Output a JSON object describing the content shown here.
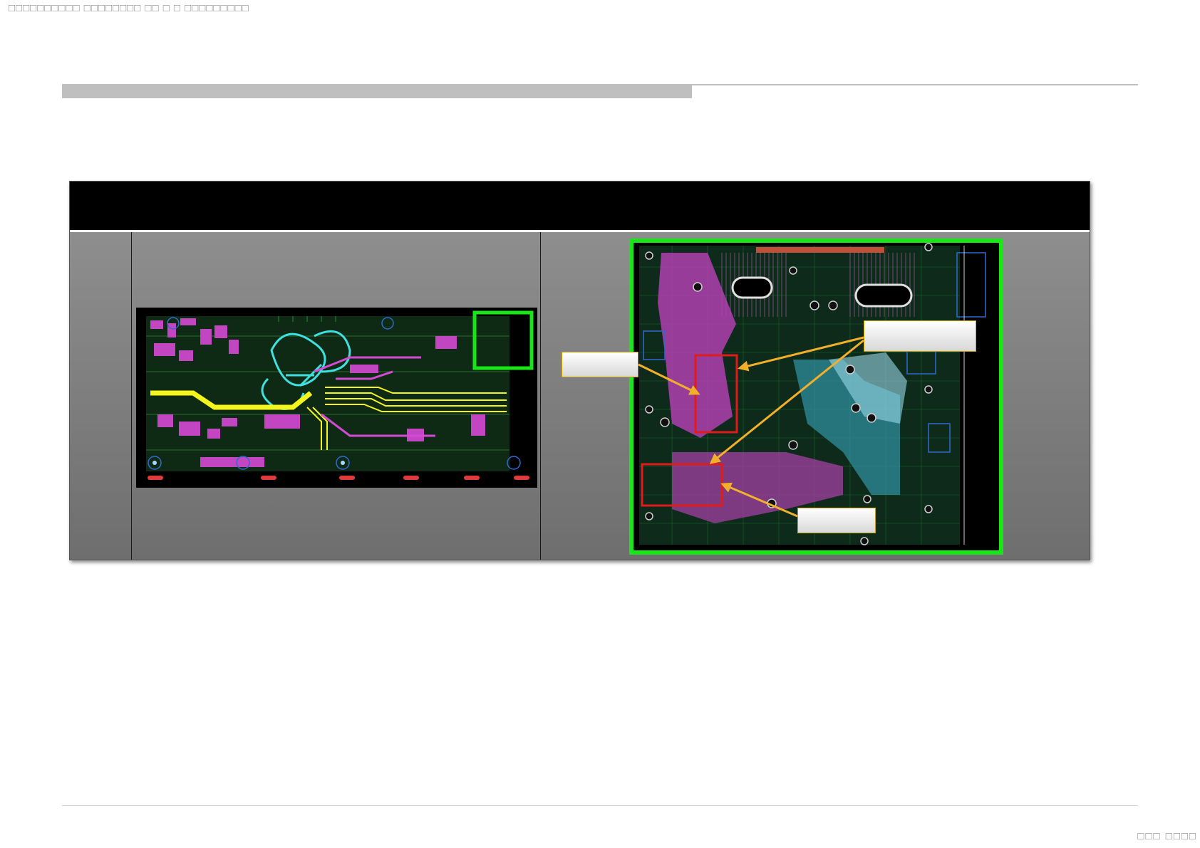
{
  "header": {
    "text": "□□□□□□□□□□ □□□□□□□□ □□ □ □ □□□□□□□□□"
  },
  "slide": {
    "title": ""
  },
  "table": {
    "header_text": "",
    "row_label": "",
    "callouts": [
      "",
      "",
      ""
    ]
  },
  "colors": {
    "pcb_background": "#000000",
    "highlight_green": "#19e619",
    "highlight_red": "#e01b1b",
    "arrow_orange": "#f2b02a",
    "copper_magenta": "#d24bd2",
    "trace_yellow": "#f5f51e",
    "trace_cyan": "#3fe0e0"
  },
  "footer": {
    "page_number": "□□□ □□□□"
  }
}
